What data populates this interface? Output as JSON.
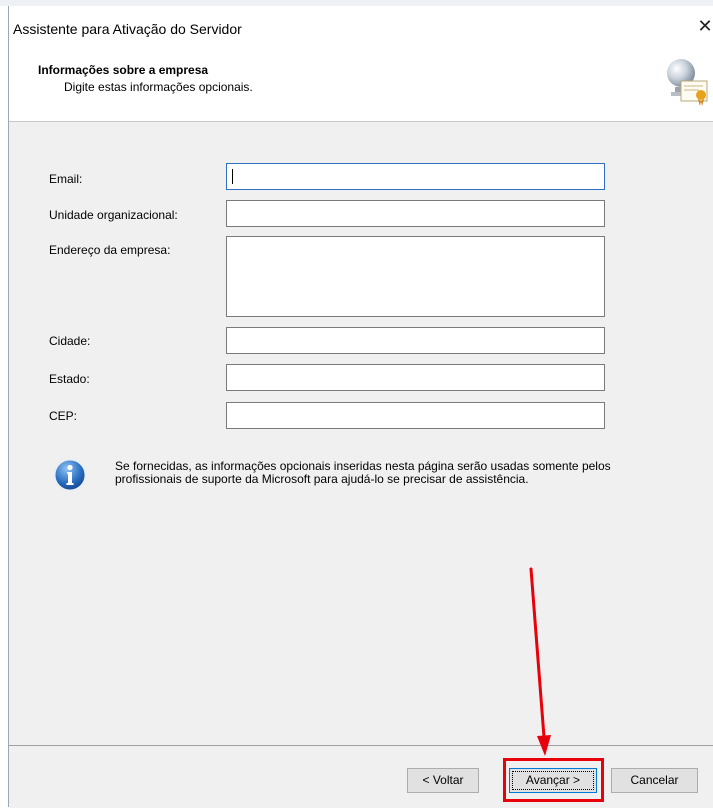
{
  "window": {
    "title": "Assistente para Ativação do Servidor",
    "close_glyph": "✕"
  },
  "header": {
    "title": "Informações sobre a empresa",
    "subtitle": "Digite estas informações opcionais.",
    "icon": "certificate-server-icon"
  },
  "form": {
    "email": {
      "label": "Email:",
      "value": ""
    },
    "org_unit": {
      "label": "Unidade organizacional:",
      "value": ""
    },
    "address": {
      "label": "Endereço da empresa:",
      "value": ""
    },
    "city": {
      "label": "Cidade:",
      "value": ""
    },
    "state": {
      "label": "Estado:",
      "value": ""
    },
    "zip": {
      "label": "CEP:",
      "value": ""
    }
  },
  "info": {
    "icon": "info-icon",
    "text": "Se fornecidas, as informações opcionais inseridas nesta página serão usadas somente pelos profissionais de suporte da Microsoft para ajudá-lo se precisar de assistência."
  },
  "footer": {
    "back_label": "< Voltar",
    "next_label": "Avançar >",
    "cancel_label": "Cancelar"
  },
  "annotation": {
    "highlight_color": "#e8000b"
  }
}
